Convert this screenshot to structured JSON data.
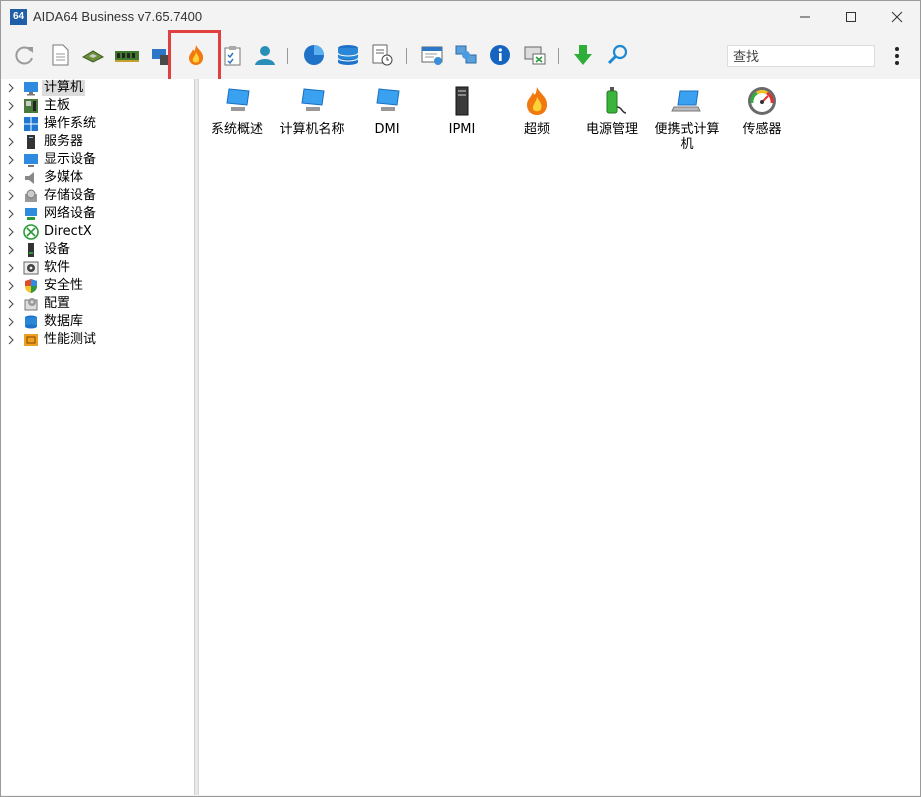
{
  "window": {
    "app_badge": "64",
    "title": "AIDA64 Business v7.65.7400"
  },
  "toolbar": {
    "search_placeholder": "查找",
    "buttons": [
      "refresh-icon",
      "report-icon",
      "cpu-icon",
      "memory-icon",
      "network-card-icon",
      "flame-icon",
      "clipboard-icon",
      "user-icon",
      "pie-chart-icon",
      "database-icon",
      "schedule-icon",
      "web-page-icon",
      "network-share-icon",
      "info-icon",
      "screenshot-icon",
      "download-arrow-icon",
      "search-icon"
    ]
  },
  "tree": {
    "items": [
      {
        "label": "计算机",
        "icon": "computer-icon",
        "selected": true
      },
      {
        "label": "主板",
        "icon": "motherboard-icon"
      },
      {
        "label": "操作系统",
        "icon": "windows-icon"
      },
      {
        "label": "服务器",
        "icon": "server-icon"
      },
      {
        "label": "显示设备",
        "icon": "monitor-icon"
      },
      {
        "label": "多媒体",
        "icon": "speaker-icon"
      },
      {
        "label": "存储设备",
        "icon": "disk-icon"
      },
      {
        "label": "网络设备",
        "icon": "network-icon"
      },
      {
        "label": "DirectX",
        "icon": "xbox-icon"
      },
      {
        "label": "设备",
        "icon": "device-icon"
      },
      {
        "label": "软件",
        "icon": "software-icon"
      },
      {
        "label": "安全性",
        "icon": "shield-icon"
      },
      {
        "label": "配置",
        "icon": "config-icon"
      },
      {
        "label": "数据库",
        "icon": "database-icon"
      },
      {
        "label": "性能测试",
        "icon": "benchmark-icon"
      }
    ]
  },
  "content": {
    "items": [
      {
        "label": "系统概述",
        "icon": "computer-icon"
      },
      {
        "label": "计算机名称",
        "icon": "computer-icon"
      },
      {
        "label": "DMI",
        "icon": "computer-icon"
      },
      {
        "label": "IPMI",
        "icon": "server-tower-icon"
      },
      {
        "label": "超频",
        "icon": "flame-icon"
      },
      {
        "label": "电源管理",
        "icon": "battery-icon"
      },
      {
        "label": "便携式计算机",
        "icon": "laptop-icon"
      },
      {
        "label": "传感器",
        "icon": "gauge-icon"
      }
    ]
  }
}
